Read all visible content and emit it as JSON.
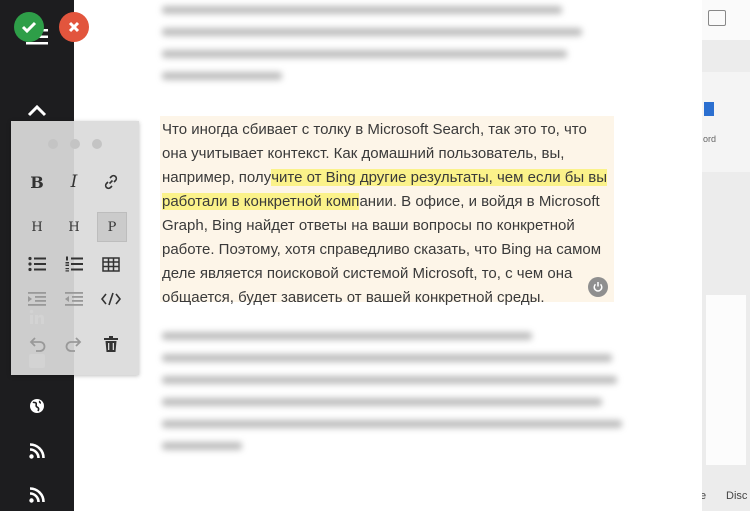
{
  "toolbar": {
    "bold_label": "B",
    "italic_label": "I",
    "heading1_label": "H",
    "heading2_label": "H",
    "paragraph_label": "P"
  },
  "content": {
    "paragraph_main": {
      "part1": "Что иногда сбивает с толку в Microsoft Search, так это то, что она учитывает контекст. Как домашний пользователь, вы, например, полу",
      "highlighted": "чите от Bing другие результаты, чем если бы вы работали в конкретной комп",
      "part2": "ании. В офисе, и войдя в Microsoft Graph, Bing найдет ответы на ваши вопросы по конкретной работе. Поэтому, хотя справедливо сказать, что Bing на самом деле является поисковой системой Microsoft, то, с чем она общается, будет зависеть от вашей конкретной среды."
    }
  },
  "right_panel": {
    "text_1": "ord",
    "text_2": "e",
    "text_3": "Disc"
  },
  "colors": {
    "sidebar_bg": "#1d1d1f",
    "check_green": "#2e9e48",
    "close_red": "#e2553d",
    "highlight_yellow": "#fbf28a",
    "block_bg": "#fdf5e8"
  }
}
